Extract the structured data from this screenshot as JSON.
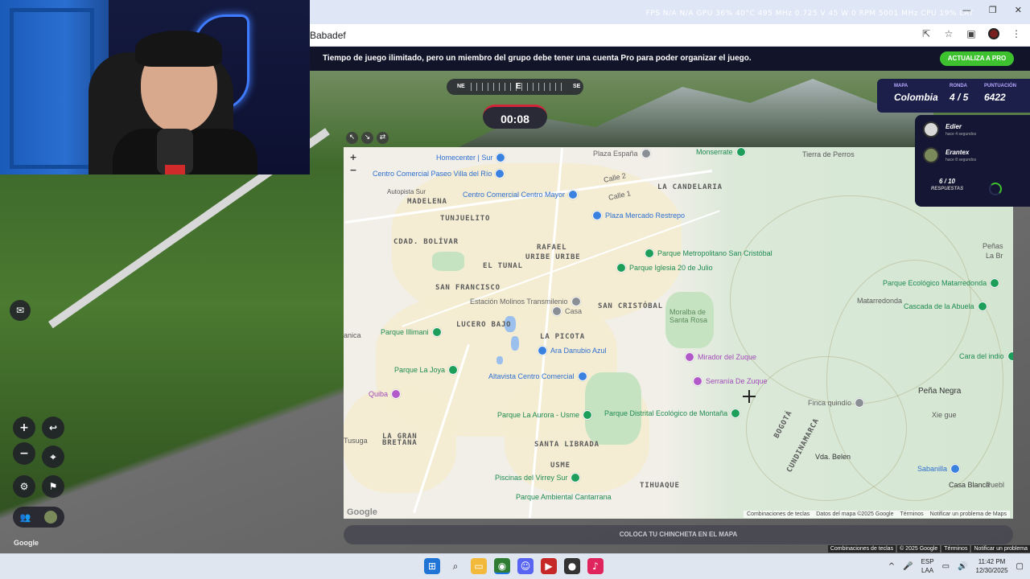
{
  "browser": {
    "stats_text": "FPS N/A N/A   GPU 36% 40°C 495 MHz 0.725 V 45 W 0 RPM 5001 MHz   CPU 19%   LAT",
    "url": "Babadef"
  },
  "promo": {
    "message": "Tiempo de juego ilimitado, pero un miembro del grupo debe tener una cuenta Pro para poder organizar el juego.",
    "button": "ACTUALIZA A PRO"
  },
  "compass": {
    "left": "NE",
    "center": "E",
    "right": "SE"
  },
  "timer": "00:08",
  "score": {
    "map_label": "MAPA",
    "map_value": "Colombia",
    "round_label": "RONDA",
    "round_value": "4 / 5",
    "points_label": "PUNTUACIÓN",
    "points_value": "6422"
  },
  "players": [
    {
      "name": "Edier",
      "time": "hace 4 segundos"
    },
    {
      "name": "Erantex",
      "time": "hace 8 segundos"
    }
  ],
  "answers": {
    "count": "6 / 10",
    "label": "RESPUESTAS"
  },
  "map": {
    "zoom_in": "+",
    "zoom_out": "−",
    "districts": [
      "LA CANDELARIA",
      "TUNJUELITO",
      "CDAD. BOLÍVAR",
      "RAFAEL",
      "URIBE URIBE",
      "SAN CRISTÓBAL",
      "LA PICOTA",
      "LUCERO BAJO",
      "EL TUNAL",
      "SAN FRANCISCO",
      "MADELENA",
      "LA GRAN",
      "BRETANA",
      "SANTA LIBRADA",
      "USME",
      "TIHUAQUE",
      "BOGOTÁ",
      "CUNDINAMARCA",
      "Calle 2",
      "Calle 1"
    ],
    "places": [
      "Tierra de Perros",
      "Matarredonda",
      "Peña Negra",
      "Vda. Belen",
      "Xie gue",
      "Casa Blanca",
      "Peñas",
      "La Br",
      "Puebl",
      "Tusuga",
      "anica",
      "Moralba de Santa Rosa"
    ],
    "pois": [
      "Plaza España",
      "Monserrate",
      "Homecenter | Sur",
      "Centro Comercial Paseo Villa del Río",
      "Centro Comercial Centro Mayor",
      "Plaza Mercado Restrepo",
      "Parque Metropolitano San Cristóbal",
      "Parque Iglesia 20 de Julio",
      "Estación Molinos Transmilenio",
      "Casa",
      "Parque Illimani",
      "Ara Danubio Azul",
      "Parque La Joya",
      "Altavista Centro Comercial",
      "Mirador del Zuque",
      "Serranía De Zuque",
      "Quiba",
      "Parque La Aurora - Usme",
      "Parque Distrital Ecológico de Montaña",
      "Piscinas del Virrey Sur",
      "Parque Ambiental Cantarrana",
      "Parque Ecológico Matarredonda",
      "Cascada de la Abuela",
      "Finca quindío",
      "Sabanilla",
      "Cara del indio",
      "Autopista Sur"
    ],
    "google": "Google",
    "attribution": [
      "Combinaciones de teclas",
      "Datos del mapa ©2025 Google",
      "Términos",
      "Notificar un problema de Maps"
    ]
  },
  "place_pin": "COLOCA TU CHINCHETA EN EL MAPA",
  "streetview": {
    "google": "Google",
    "attribution": [
      "Combinaciones de teclas",
      "© 2025 Google",
      "Términos",
      "Notificar un problema"
    ]
  },
  "taskbar": {
    "lang1": "ESP",
    "lang2": "LAA",
    "time": "11:42 PM",
    "date": "12/30/2025"
  }
}
